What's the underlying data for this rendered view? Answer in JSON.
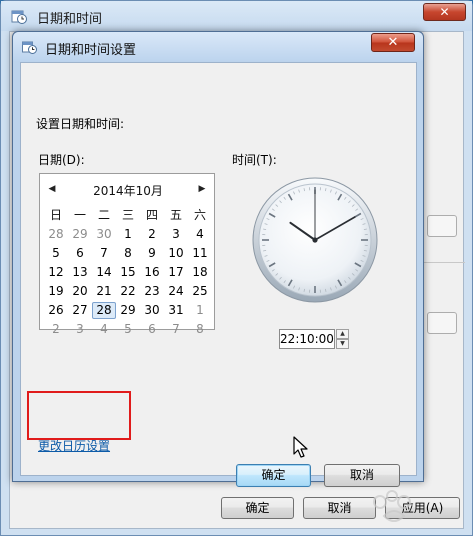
{
  "outer_window": {
    "title": "日期和时间",
    "close_glyph": "✕",
    "buttons": {
      "ok": "确定",
      "cancel": "取消",
      "apply": "应用(A)"
    }
  },
  "dialog": {
    "title": "日期和时间设置",
    "close_glyph": "✕",
    "prompt": "设置日期和时间:",
    "date_label": "日期(D):",
    "time_label": "时间(T):",
    "change_calendar_link": "更改日历设置",
    "ok_button": "确定",
    "cancel_button": "取消"
  },
  "calendar": {
    "prev_glyph": "◀",
    "next_glyph": "▶",
    "month_label": "2014年10月",
    "weekdays": [
      "日",
      "一",
      "二",
      "三",
      "四",
      "五",
      "六"
    ],
    "weeks": [
      [
        "28",
        "29",
        "30",
        "1",
        "2",
        "3",
        "4"
      ],
      [
        "5",
        "6",
        "7",
        "8",
        "9",
        "10",
        "11"
      ],
      [
        "12",
        "13",
        "14",
        "15",
        "16",
        "17",
        "18"
      ],
      [
        "19",
        "20",
        "21",
        "22",
        "23",
        "24",
        "25"
      ],
      [
        "26",
        "27",
        "28",
        "29",
        "30",
        "31",
        "1"
      ],
      [
        "2",
        "3",
        "4",
        "5",
        "6",
        "7",
        "8"
      ]
    ],
    "selected_day": "28"
  },
  "clock": {
    "hour": 22,
    "minute": 10,
    "second": 0
  },
  "time_input": {
    "value": "22:10:00",
    "spin_up_glyph": "▲",
    "spin_down_glyph": "▼"
  },
  "icons": {
    "window_icon": "calendar-clock-icon",
    "cursor": "mouse-pointer-icon"
  },
  "colors": {
    "link": "#0d5ba8",
    "highlight_box": "#e01b1b",
    "close_button": "#c7462e"
  }
}
